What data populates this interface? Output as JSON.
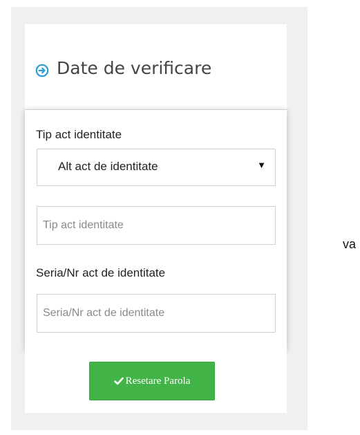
{
  "panel": {
    "title": "Date de verificare",
    "icon": "circle-arrow-right-icon",
    "accent_color": "#2a9fd6"
  },
  "form": {
    "id_type_label": "Tip act identitate",
    "id_type_selected": "Alt act de identitate",
    "id_type_input_placeholder": "Tip act identitate",
    "series_label": "Seria/Nr act de identitate",
    "series_input_placeholder": "Seria/Nr act de identitate"
  },
  "actions": {
    "reset_label": "Resetare Parola",
    "reset_icon": "check-icon",
    "button_color": "#42b347"
  },
  "side_text": "va"
}
